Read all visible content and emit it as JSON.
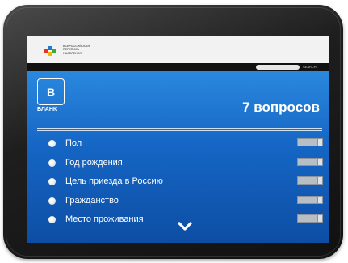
{
  "header": {
    "logo_text": [
      "ВСЕРОССИЙСКАЯ",
      "ПЕРЕПИСЬ",
      "НАСЕЛЕНИЯ"
    ],
    "search_label": "SEARCH"
  },
  "form": {
    "card_letter": "B",
    "card_label": "БЛАНК",
    "questions_count": "7 вопросов"
  },
  "questions": [
    {
      "label": "Пол"
    },
    {
      "label": "Год рождения"
    },
    {
      "label": "Цель приезда в Россию"
    },
    {
      "label": "Гражданство"
    },
    {
      "label": "Место проживания"
    }
  ],
  "colors": {
    "accent": "#1a6fd1",
    "logo_red": "#e4322b",
    "logo_blue": "#1f7ad4",
    "logo_green": "#3aaa35",
    "logo_yellow": "#f2b300"
  },
  "icons": {
    "scroll_more": "chevron-down-icon"
  }
}
